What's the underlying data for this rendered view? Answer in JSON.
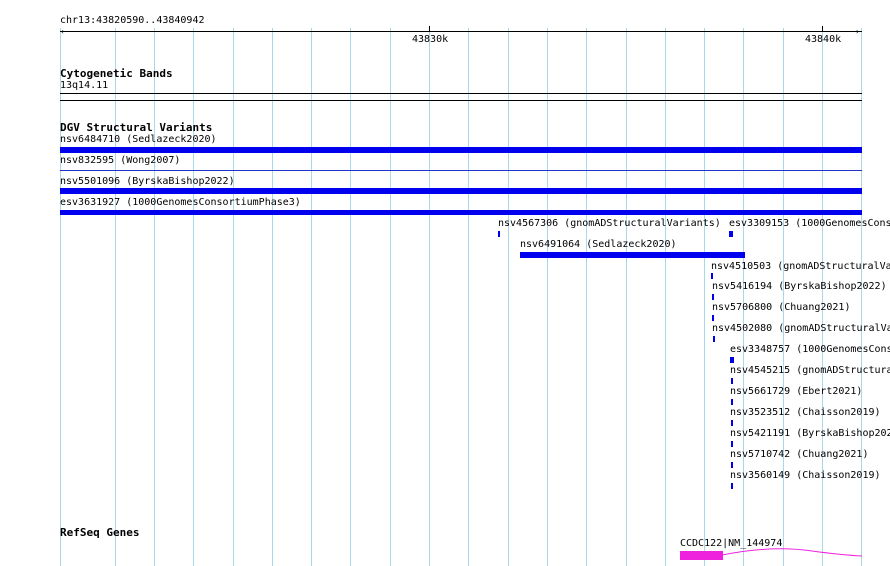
{
  "ruler": {
    "range_label": "chr13:43820590..43840942",
    "major_ticks": [
      {
        "label": "43830k"
      },
      {
        "label": "43840k"
      }
    ]
  },
  "tracks": {
    "cytobands": {
      "title": "Cytogenetic Bands",
      "band": "13q14.11"
    },
    "dgv": {
      "title": "DGV Structural Variants",
      "variants": [
        {
          "label": "nsv6484710 (Sedlazeck2020)"
        },
        {
          "label": "nsv832595 (Wong2007)"
        },
        {
          "label": "nsv5501096 (ByrskaBishop2022)"
        },
        {
          "label": "esv3631927 (1000GenomesConsortiumPhase3)"
        },
        {
          "label": "nsv4567306 (gnomADStructuralVariants)"
        },
        {
          "label": "esv3309153 (1000GenomesCons"
        },
        {
          "label": "nsv6491064 (Sedlazeck2020)"
        },
        {
          "label": "nsv4510503 (gnomADStructuralVa"
        },
        {
          "label": "nsv5416194 (ByrskaBishop2022)"
        },
        {
          "label": "nsv5706800 (Chuang2021)"
        },
        {
          "label": "nsv4502080 (gnomADStructuralVa"
        },
        {
          "label": "esv3348757 (1000GenomesCons"
        },
        {
          "label": "nsv4545215 (gnomADStructura"
        },
        {
          "label": "nsv5661729 (Ebert2021)"
        },
        {
          "label": "nsv3523512 (Chaisson2019)"
        },
        {
          "label": "nsv5421191 (ByrskaBishop202"
        },
        {
          "label": "nsv5710742 (Chuang2021)"
        },
        {
          "label": "nsv3560149 (Chaisson2019)"
        }
      ]
    },
    "refseq": {
      "title": "RefSeq Genes",
      "genes": [
        {
          "label": "CCDC122|NM_144974"
        }
      ]
    }
  },
  "colors": {
    "variant": "#0000ee",
    "gene": "#ee22dd",
    "grid": "#a8d8ea"
  }
}
